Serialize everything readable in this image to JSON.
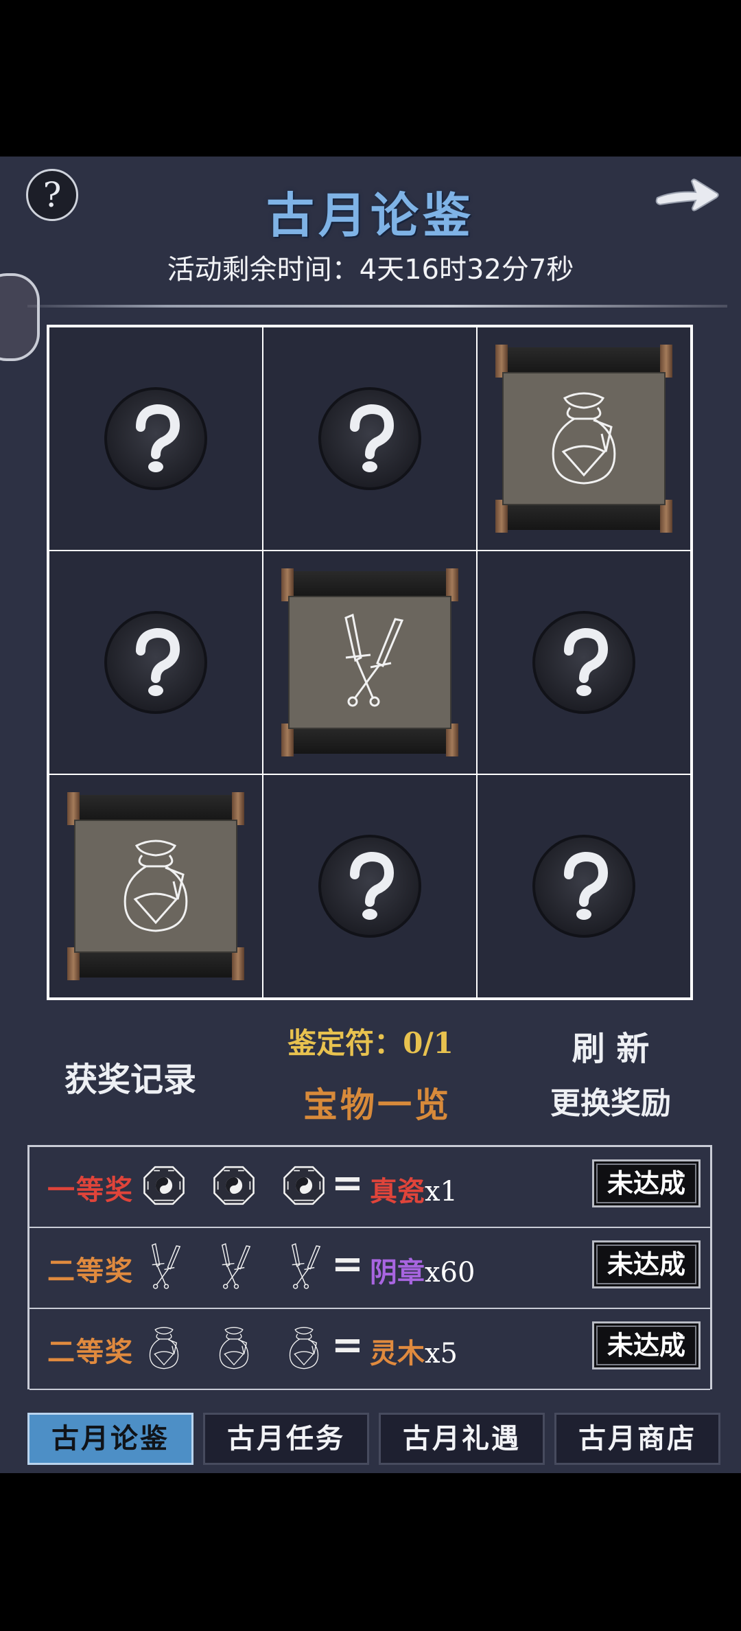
{
  "header": {
    "help_label": "?",
    "title": "古月论鉴",
    "timer": "活动剩余时间：4天16时32分7秒"
  },
  "grid": {
    "cells": [
      {
        "state": "hidden",
        "icon": "question-mark-icon"
      },
      {
        "state": "hidden",
        "icon": "question-mark-icon"
      },
      {
        "state": "revealed",
        "icon": "pouch-icon"
      },
      {
        "state": "hidden",
        "icon": "question-mark-icon"
      },
      {
        "state": "revealed",
        "icon": "crossed-swords-icon"
      },
      {
        "state": "hidden",
        "icon": "question-mark-icon"
      },
      {
        "state": "revealed",
        "icon": "pouch-icon"
      },
      {
        "state": "hidden",
        "icon": "question-mark-icon"
      },
      {
        "state": "hidden",
        "icon": "question-mark-icon"
      }
    ]
  },
  "actions": {
    "ticket": "鉴定符：0/1",
    "records": "获奖记录",
    "treasures": "宝物一览",
    "refresh": "刷 新",
    "change_reward": "更换奖励"
  },
  "rewards": [
    {
      "rank": "一等奖",
      "rank_color": "#e0443a",
      "icon": "bagua-icon",
      "equals": "=",
      "prize": "真瓷",
      "prize_color": "#e0443a",
      "qty": "x1",
      "status": "未达成"
    },
    {
      "rank": "二等奖",
      "rank_color": "#e08a3e",
      "icon": "crossed-swords-icon",
      "equals": "=",
      "prize": "阴章",
      "prize_color": "#a865e0",
      "qty": "x60",
      "status": "未达成"
    },
    {
      "rank": "二等奖",
      "rank_color": "#e08a3e",
      "icon": "pouch-icon",
      "equals": "=",
      "prize": "灵木",
      "prize_color": "#e08a3e",
      "qty": "x5",
      "status": "未达成"
    }
  ],
  "tabs": [
    {
      "label": "古月论鉴",
      "active": true
    },
    {
      "label": "古月任务",
      "active": false
    },
    {
      "label": "古月礼遇",
      "active": false
    },
    {
      "label": "古月商店",
      "active": false
    }
  ]
}
